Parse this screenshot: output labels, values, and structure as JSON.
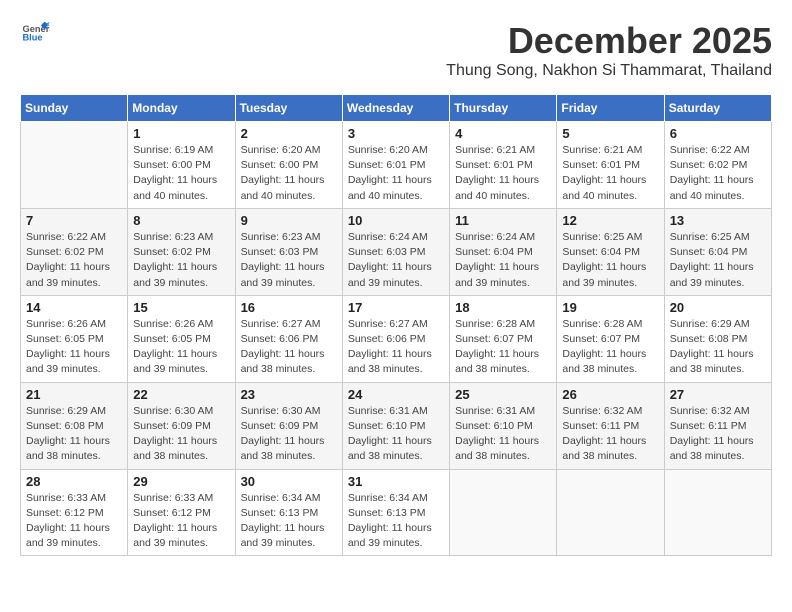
{
  "header": {
    "logo_general": "General",
    "logo_blue": "Blue",
    "month_title": "December 2025",
    "subtitle": "Thung Song, Nakhon Si Thammarat, Thailand"
  },
  "calendar": {
    "days_of_week": [
      "Sunday",
      "Monday",
      "Tuesday",
      "Wednesday",
      "Thursday",
      "Friday",
      "Saturday"
    ],
    "weeks": [
      [
        {
          "day": "",
          "info": ""
        },
        {
          "day": "1",
          "info": "Sunrise: 6:19 AM\nSunset: 6:00 PM\nDaylight: 11 hours\nand 40 minutes."
        },
        {
          "day": "2",
          "info": "Sunrise: 6:20 AM\nSunset: 6:00 PM\nDaylight: 11 hours\nand 40 minutes."
        },
        {
          "day": "3",
          "info": "Sunrise: 6:20 AM\nSunset: 6:01 PM\nDaylight: 11 hours\nand 40 minutes."
        },
        {
          "day": "4",
          "info": "Sunrise: 6:21 AM\nSunset: 6:01 PM\nDaylight: 11 hours\nand 40 minutes."
        },
        {
          "day": "5",
          "info": "Sunrise: 6:21 AM\nSunset: 6:01 PM\nDaylight: 11 hours\nand 40 minutes."
        },
        {
          "day": "6",
          "info": "Sunrise: 6:22 AM\nSunset: 6:02 PM\nDaylight: 11 hours\nand 40 minutes."
        }
      ],
      [
        {
          "day": "7",
          "info": "Sunrise: 6:22 AM\nSunset: 6:02 PM\nDaylight: 11 hours\nand 39 minutes."
        },
        {
          "day": "8",
          "info": "Sunrise: 6:23 AM\nSunset: 6:02 PM\nDaylight: 11 hours\nand 39 minutes."
        },
        {
          "day": "9",
          "info": "Sunrise: 6:23 AM\nSunset: 6:03 PM\nDaylight: 11 hours\nand 39 minutes."
        },
        {
          "day": "10",
          "info": "Sunrise: 6:24 AM\nSunset: 6:03 PM\nDaylight: 11 hours\nand 39 minutes."
        },
        {
          "day": "11",
          "info": "Sunrise: 6:24 AM\nSunset: 6:04 PM\nDaylight: 11 hours\nand 39 minutes."
        },
        {
          "day": "12",
          "info": "Sunrise: 6:25 AM\nSunset: 6:04 PM\nDaylight: 11 hours\nand 39 minutes."
        },
        {
          "day": "13",
          "info": "Sunrise: 6:25 AM\nSunset: 6:04 PM\nDaylight: 11 hours\nand 39 minutes."
        }
      ],
      [
        {
          "day": "14",
          "info": "Sunrise: 6:26 AM\nSunset: 6:05 PM\nDaylight: 11 hours\nand 39 minutes."
        },
        {
          "day": "15",
          "info": "Sunrise: 6:26 AM\nSunset: 6:05 PM\nDaylight: 11 hours\nand 39 minutes."
        },
        {
          "day": "16",
          "info": "Sunrise: 6:27 AM\nSunset: 6:06 PM\nDaylight: 11 hours\nand 38 minutes."
        },
        {
          "day": "17",
          "info": "Sunrise: 6:27 AM\nSunset: 6:06 PM\nDaylight: 11 hours\nand 38 minutes."
        },
        {
          "day": "18",
          "info": "Sunrise: 6:28 AM\nSunset: 6:07 PM\nDaylight: 11 hours\nand 38 minutes."
        },
        {
          "day": "19",
          "info": "Sunrise: 6:28 AM\nSunset: 6:07 PM\nDaylight: 11 hours\nand 38 minutes."
        },
        {
          "day": "20",
          "info": "Sunrise: 6:29 AM\nSunset: 6:08 PM\nDaylight: 11 hours\nand 38 minutes."
        }
      ],
      [
        {
          "day": "21",
          "info": "Sunrise: 6:29 AM\nSunset: 6:08 PM\nDaylight: 11 hours\nand 38 minutes."
        },
        {
          "day": "22",
          "info": "Sunrise: 6:30 AM\nSunset: 6:09 PM\nDaylight: 11 hours\nand 38 minutes."
        },
        {
          "day": "23",
          "info": "Sunrise: 6:30 AM\nSunset: 6:09 PM\nDaylight: 11 hours\nand 38 minutes."
        },
        {
          "day": "24",
          "info": "Sunrise: 6:31 AM\nSunset: 6:10 PM\nDaylight: 11 hours\nand 38 minutes."
        },
        {
          "day": "25",
          "info": "Sunrise: 6:31 AM\nSunset: 6:10 PM\nDaylight: 11 hours\nand 38 minutes."
        },
        {
          "day": "26",
          "info": "Sunrise: 6:32 AM\nSunset: 6:11 PM\nDaylight: 11 hours\nand 38 minutes."
        },
        {
          "day": "27",
          "info": "Sunrise: 6:32 AM\nSunset: 6:11 PM\nDaylight: 11 hours\nand 38 minutes."
        }
      ],
      [
        {
          "day": "28",
          "info": "Sunrise: 6:33 AM\nSunset: 6:12 PM\nDaylight: 11 hours\nand 39 minutes."
        },
        {
          "day": "29",
          "info": "Sunrise: 6:33 AM\nSunset: 6:12 PM\nDaylight: 11 hours\nand 39 minutes."
        },
        {
          "day": "30",
          "info": "Sunrise: 6:34 AM\nSunset: 6:13 PM\nDaylight: 11 hours\nand 39 minutes."
        },
        {
          "day": "31",
          "info": "Sunrise: 6:34 AM\nSunset: 6:13 PM\nDaylight: 11 hours\nand 39 minutes."
        },
        {
          "day": "",
          "info": ""
        },
        {
          "day": "",
          "info": ""
        },
        {
          "day": "",
          "info": ""
        }
      ]
    ]
  }
}
